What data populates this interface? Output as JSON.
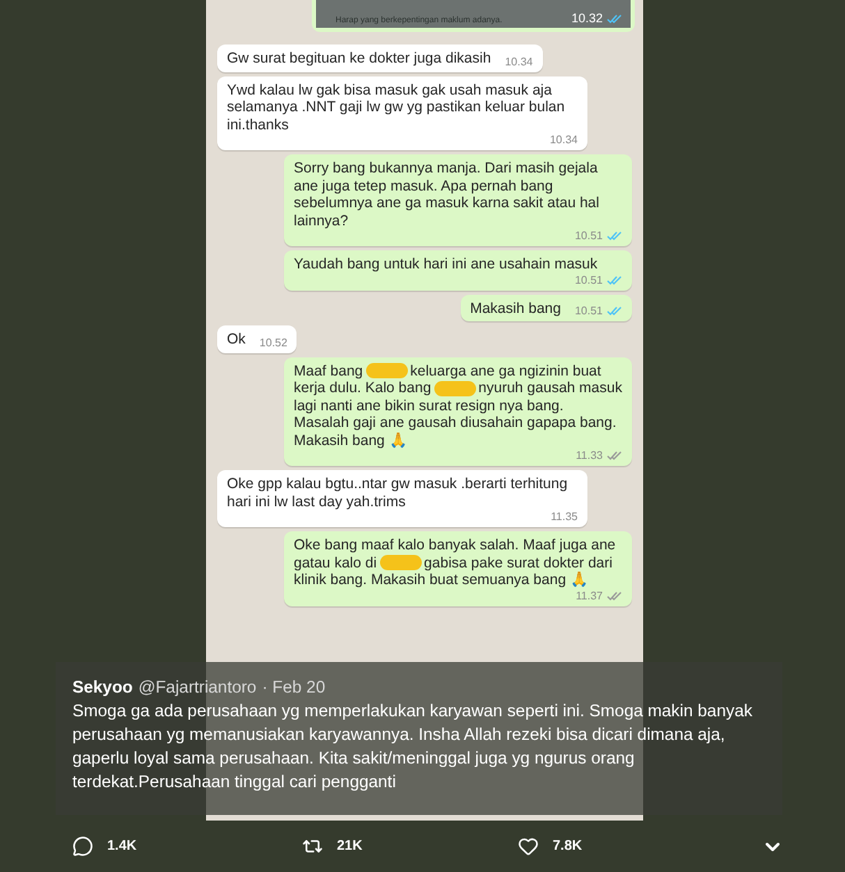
{
  "chat": {
    "image_message": {
      "caption": "Harap yang berkepentingan maklum adanya.",
      "time": "10.32",
      "read": true
    },
    "messages": [
      {
        "kind": "in",
        "segments": [
          {
            "kind": "text",
            "text": "Gw surat begituan ke dokter juga dikasih"
          }
        ],
        "time": "10.34"
      },
      {
        "kind": "in",
        "segments": [
          {
            "kind": "text",
            "text": "Ywd kalau lw gak bisa masuk gak usah masuk aja selamanya .NNT gaji lw gw yg pastikan keluar bulan ini.thanks"
          }
        ],
        "time": "10.34"
      },
      {
        "kind": "out",
        "segments": [
          {
            "kind": "text",
            "text": "Sorry bang bukannya manja. Dari masih gejala ane juga tetep masuk. Apa pernah bang sebelumnya ane ga masuk karna sakit atau hal lainnya?"
          }
        ],
        "time": "10.51",
        "read": true
      },
      {
        "kind": "out",
        "segments": [
          {
            "kind": "text",
            "text": "Yaudah bang untuk hari ini ane usahain masuk"
          }
        ],
        "time": "10.51",
        "read": true
      },
      {
        "kind": "out",
        "segments": [
          {
            "kind": "text",
            "text": "Makasih bang"
          }
        ],
        "time": "10.51",
        "read": true
      },
      {
        "kind": "in",
        "segments": [
          {
            "kind": "text",
            "text": "Ok"
          }
        ],
        "time": "10.52"
      },
      {
        "kind": "out",
        "segments": [
          {
            "kind": "text",
            "text": "Maaf bang"
          },
          {
            "kind": "redacted"
          },
          {
            "kind": "text",
            "text": "keluarga ane ga ngizinin buat kerja dulu. Kalo bang"
          },
          {
            "kind": "redacted"
          },
          {
            "kind": "text",
            "text": "nyuruh gausah masuk lagi nanti ane bikin surat resign nya bang. Masalah gaji ane gausah diusahain gapapa bang. Makasih bang 🙏"
          }
        ],
        "time": "11.33",
        "read": false
      },
      {
        "kind": "in",
        "segments": [
          {
            "kind": "text",
            "text": "Oke gpp kalau bgtu..ntar gw masuk .berarti terhitung hari ini lw last day yah.trims"
          }
        ],
        "time": "11.35"
      },
      {
        "kind": "out",
        "segments": [
          {
            "kind": "text",
            "text": "Oke bang maaf kalo banyak salah. Maaf juga ane gatau kalo di"
          },
          {
            "kind": "redacted"
          },
          {
            "kind": "text",
            "text": "gabisa pake surat dokter dari klinik bang. Makasih buat semuanya bang 🙏"
          }
        ],
        "time": "11.37",
        "read": false
      }
    ]
  },
  "tweet": {
    "name": "Sekyoo",
    "handle": "@Fajartriantoro",
    "date": "· Feb 20",
    "text": "Smoga ga ada perusahaan yg memperlakukan karyawan seperti ini. Smoga makin banyak perusahaan yg memanusiakan karyawannya. Insha Allah rezeki bisa dicari dimana aja, gaperlu loyal sama perusahaan. Kita sakit/meninggal juga yg ngurus orang terdekat.Perusahaan tinggal cari pengganti"
  },
  "actions": [
    {
      "kind": "reply",
      "count": "1.4K"
    },
    {
      "kind": "retweet",
      "count": "21K"
    },
    {
      "kind": "like",
      "count": "7.8K"
    }
  ]
}
